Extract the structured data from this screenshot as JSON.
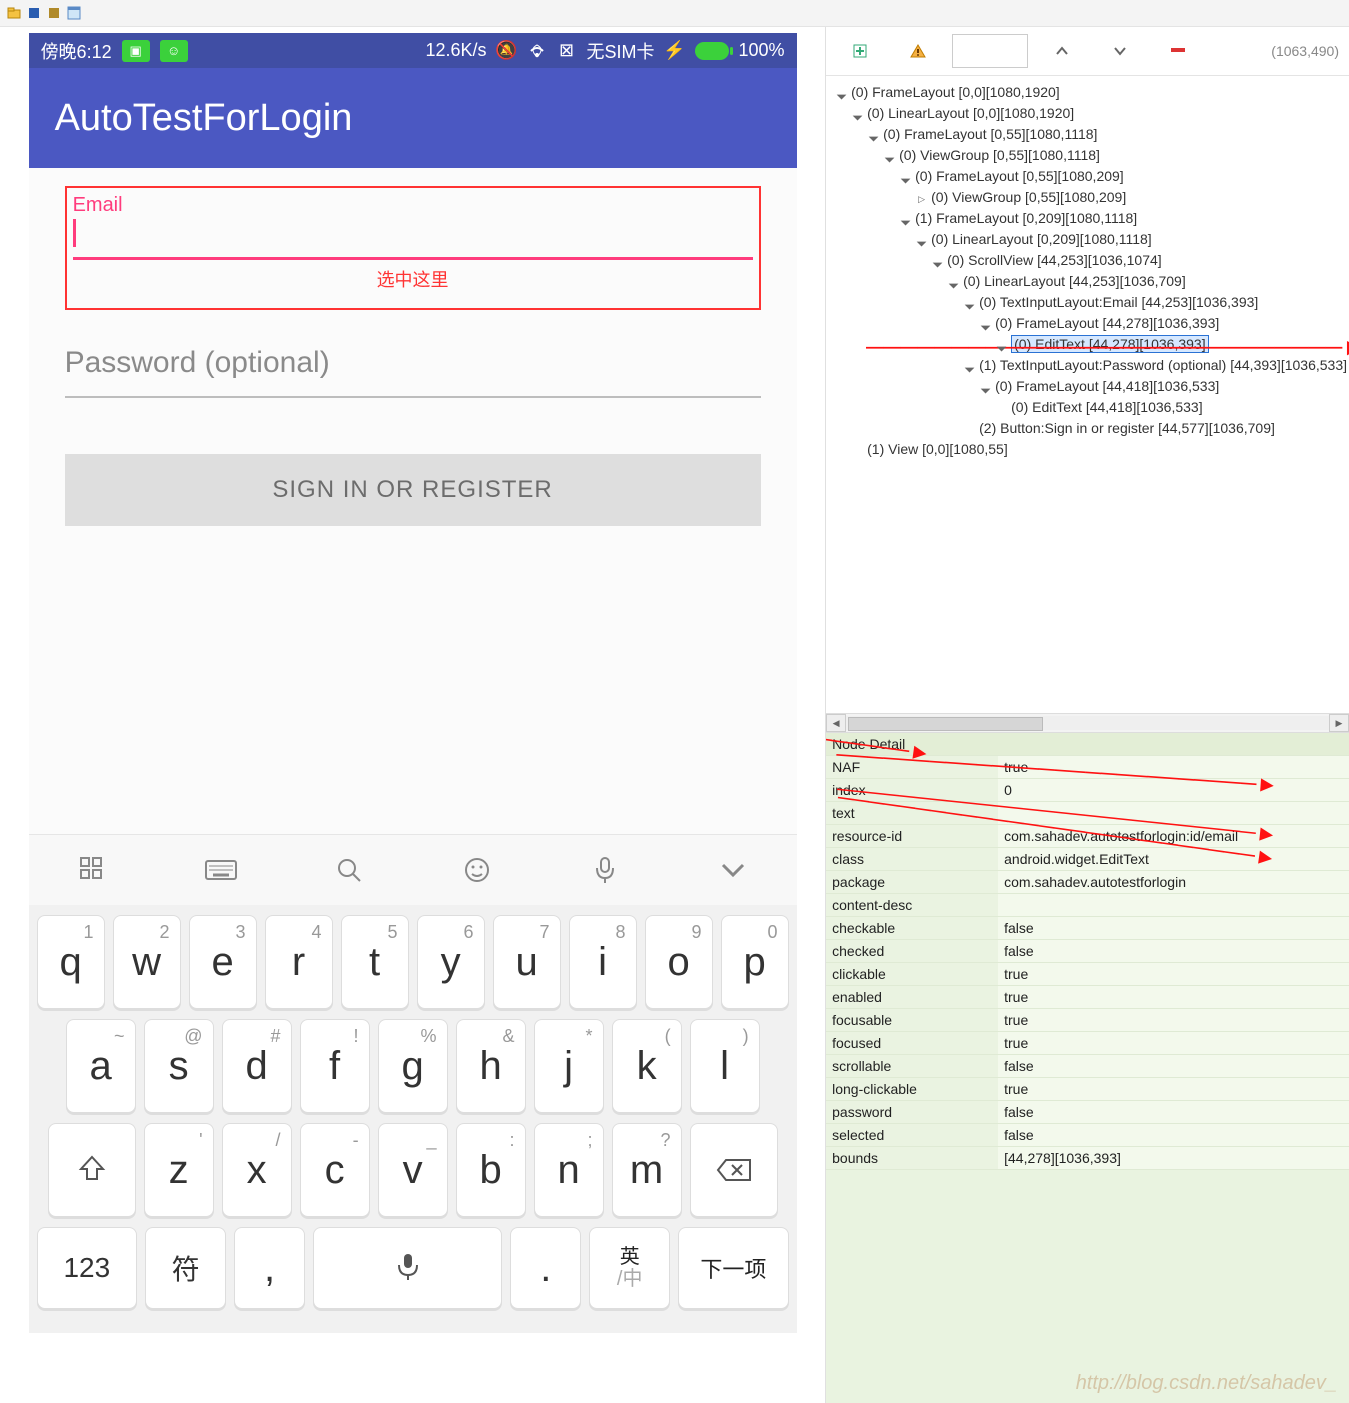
{
  "topbar_icons": [
    "open-folder-icon",
    "disk-blue-icon",
    "disk-gold-icon",
    "window-icon"
  ],
  "statusbar": {
    "time": "傍晚6:12",
    "netspeed": "12.6K/s",
    "sim": "无SIM卡",
    "batt": "100%"
  },
  "app": {
    "title": "AutoTestForLogin",
    "email_label": "Email",
    "select_hint": "选中这里",
    "password_ph": "Password (optional)",
    "button": "SIGN IN OR REGISTER"
  },
  "keyboard": {
    "row1": [
      {
        "s": "1",
        "m": "q"
      },
      {
        "s": "2",
        "m": "w"
      },
      {
        "s": "3",
        "m": "e"
      },
      {
        "s": "4",
        "m": "r"
      },
      {
        "s": "5",
        "m": "t"
      },
      {
        "s": "6",
        "m": "y"
      },
      {
        "s": "7",
        "m": "u"
      },
      {
        "s": "8",
        "m": "i"
      },
      {
        "s": "9",
        "m": "o"
      },
      {
        "s": "0",
        "m": "p"
      }
    ],
    "row2": [
      {
        "s": "~",
        "m": "a"
      },
      {
        "s": "@",
        "m": "s"
      },
      {
        "s": "#",
        "m": "d"
      },
      {
        "s": "!",
        "m": "f"
      },
      {
        "s": "%",
        "m": "g"
      },
      {
        "s": "&",
        "m": "h"
      },
      {
        "s": "*",
        "m": "j"
      },
      {
        "s": "(",
        "m": "k"
      },
      {
        "s": ")",
        "m": "l"
      }
    ],
    "row3": [
      {
        "s": "'",
        "m": "z"
      },
      {
        "s": "/",
        "m": "x"
      },
      {
        "s": "-",
        "m": "c"
      },
      {
        "s": "_",
        "m": "v"
      },
      {
        "s": ":",
        "m": "b"
      },
      {
        "s": ";",
        "m": "n"
      },
      {
        "s": "?",
        "m": "m"
      }
    ],
    "row4": {
      "k123": "123",
      "fu": "符",
      "comma": ",",
      "dot": ".",
      "eng_top": "英",
      "eng_bot": "/中",
      "next": "下一项"
    }
  },
  "right_toolbar": {
    "coords": "(1063,490)"
  },
  "tree": [
    {
      "d": 0,
      "t": "(0) FrameLayout [0,0][1080,1920]"
    },
    {
      "d": 1,
      "t": "(0) LinearLayout [0,0][1080,1920]"
    },
    {
      "d": 2,
      "t": "(0) FrameLayout [0,55][1080,1118]"
    },
    {
      "d": 3,
      "t": "(0) ViewGroup [0,55][1080,1118]"
    },
    {
      "d": 4,
      "t": "(0) FrameLayout [0,55][1080,209]"
    },
    {
      "d": 5,
      "t": "(0) ViewGroup [0,55][1080,209]",
      "closed": true
    },
    {
      "d": 4,
      "t": "(1) FrameLayout [0,209][1080,1118]"
    },
    {
      "d": 5,
      "t": "(0) LinearLayout [0,209][1080,1118]"
    },
    {
      "d": 6,
      "t": "(0) ScrollView [44,253][1036,1074]"
    },
    {
      "d": 7,
      "t": "(0) LinearLayout [44,253][1036,709]"
    },
    {
      "d": 8,
      "t": "(0) TextInputLayout:Email [44,253][1036,393]"
    },
    {
      "d": 9,
      "t": "(0) FrameLayout [44,278][1036,393]"
    },
    {
      "d": 10,
      "t": "(0) EditText [44,278][1036,393]",
      "sel": true
    },
    {
      "d": 8,
      "t": "(1) TextInputLayout:Password (optional) [44,393][1036,533]"
    },
    {
      "d": 9,
      "t": "(0) FrameLayout [44,418][1036,533]"
    },
    {
      "d": 10,
      "t": "(0) EditText [44,418][1036,533]",
      "leaf": true
    },
    {
      "d": 8,
      "t": "(2) Button:Sign in or register [44,577][1036,709]",
      "leaf": true
    },
    {
      "d": 1,
      "t": "(1) View [0,0][1080,55]",
      "leaf": true
    }
  ],
  "node_detail_header": "Node Detail",
  "node_detail": [
    {
      "k": "NAF",
      "v": "true"
    },
    {
      "k": "index",
      "v": "0"
    },
    {
      "k": "text",
      "v": ""
    },
    {
      "k": "resource-id",
      "v": "com.sahadev.autotestforlogin:id/email"
    },
    {
      "k": "class",
      "v": "android.widget.EditText"
    },
    {
      "k": "package",
      "v": "com.sahadev.autotestforlogin"
    },
    {
      "k": "content-desc",
      "v": ""
    },
    {
      "k": "checkable",
      "v": "false"
    },
    {
      "k": "checked",
      "v": "false"
    },
    {
      "k": "clickable",
      "v": "true"
    },
    {
      "k": "enabled",
      "v": "true"
    },
    {
      "k": "focusable",
      "v": "true"
    },
    {
      "k": "focused",
      "v": "true"
    },
    {
      "k": "scrollable",
      "v": "false"
    },
    {
      "k": "long-clickable",
      "v": "true"
    },
    {
      "k": "password",
      "v": "false"
    },
    {
      "k": "selected",
      "v": "false"
    },
    {
      "k": "bounds",
      "v": "[44,278][1036,393]"
    }
  ],
  "watermark": "http://blog.csdn.net/sahadev_"
}
